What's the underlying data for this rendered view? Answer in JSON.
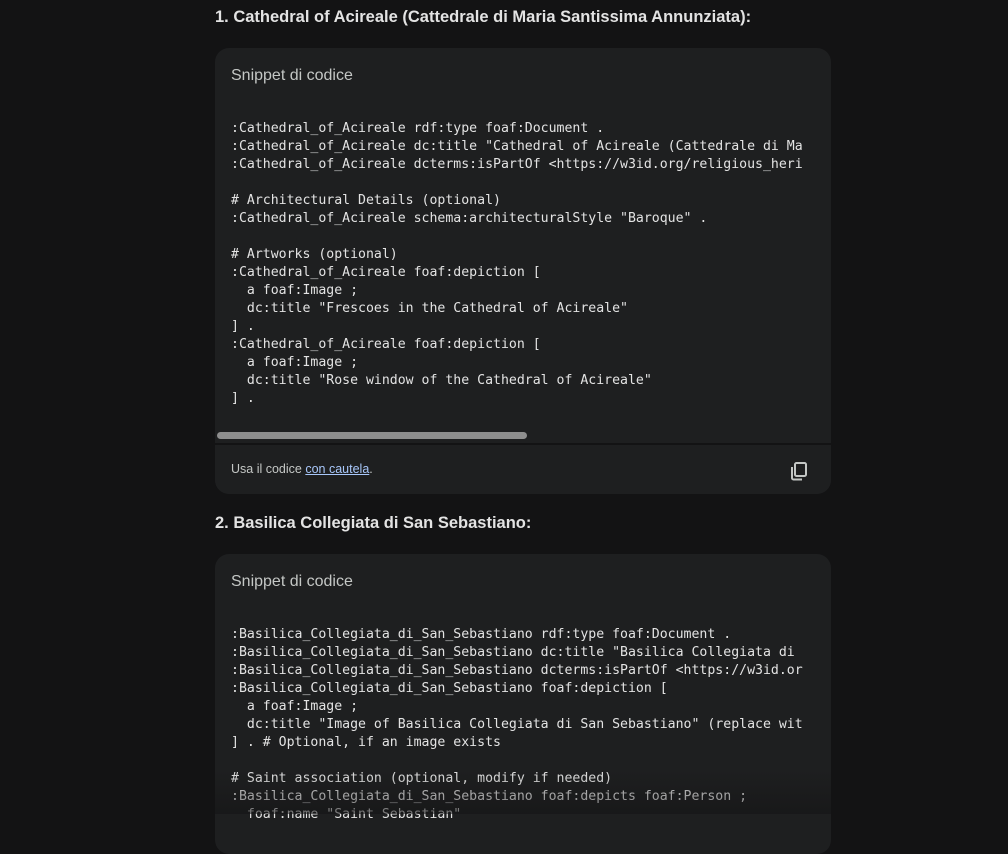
{
  "sections": [
    {
      "heading": "1. Cathedral of Acireale (Cattedrale di Maria Santissima Annunziata):",
      "snippet_title": "Snippet di codice",
      "code_lines": [
        ":Cathedral_of_Acireale rdf:type foaf:Document .",
        ":Cathedral_of_Acireale dc:title \"Cathedral of Acireale (Cattedrale di Ma",
        ":Cathedral_of_Acireale dcterms:isPartOf <https://w3id.org/religious_heri",
        "",
        "# Architectural Details (optional)",
        ":Cathedral_of_Acireale schema:architecturalStyle \"Baroque\" .",
        "",
        "# Artworks (optional)",
        ":Cathedral_of_Acireale foaf:depiction [",
        "  a foaf:Image ;",
        "  dc:title \"Frescoes in the Cathedral of Acireale\"",
        "] .",
        ":Cathedral_of_Acireale foaf:depiction [",
        "  a foaf:Image ;",
        "  dc:title \"Rose window of the Cathedral of Acireale\"",
        "] ."
      ],
      "footer_prefix": "Usa il codice ",
      "footer_link": "con cautela",
      "footer_suffix": ".",
      "copy_icon": "copy-icon"
    },
    {
      "heading": "2. Basilica Collegiata di San Sebastiano:",
      "snippet_title": "Snippet di codice",
      "code_lines": [
        ":Basilica_Collegiata_di_San_Sebastiano rdf:type foaf:Document .",
        ":Basilica_Collegiata_di_San_Sebastiano dc:title \"Basilica Collegiata di",
        ":Basilica_Collegiata_di_San_Sebastiano dcterms:isPartOf <https://w3id.or",
        ":Basilica_Collegiata_di_San_Sebastiano foaf:depiction [",
        "  a foaf:Image ;",
        "  dc:title \"Image of Basilica Collegiata di San Sebastiano\" (replace wit",
        "] . # Optional, if an image exists",
        "",
        "# Saint association (optional, modify if needed)",
        ":Basilica_Collegiata_di_San_Sebastiano foaf:depicts foaf:Person ;",
        "  foaf:name \"Saint Sebastian\""
      ]
    }
  ],
  "colors": {
    "background": "#131314",
    "code_block": "#1e1f20",
    "link": "#a8c7fa",
    "scrollbar_thumb": "#8e8e8e"
  }
}
